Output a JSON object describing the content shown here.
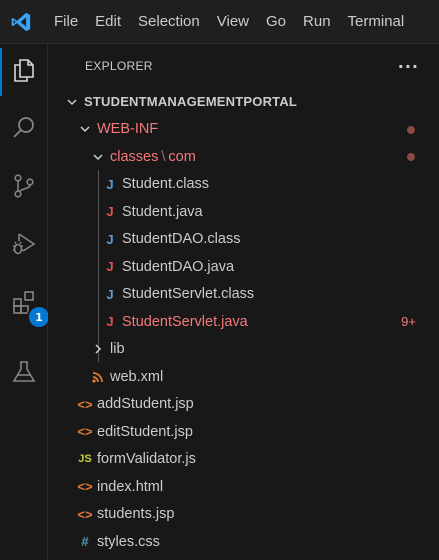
{
  "menu": [
    "File",
    "Edit",
    "Selection",
    "View",
    "Go",
    "Run",
    "Terminal"
  ],
  "activity_bar": {
    "items": [
      "explorer-icon",
      "search-icon",
      "source-control-icon",
      "run-debug-icon",
      "extensions-icon",
      "testing-icon"
    ],
    "extensions_badge": "1",
    "accent": "#0078d4"
  },
  "explorer": {
    "title": "EXPLORER",
    "more_actions": "···",
    "root": "STUDENTMANAGEMENTPORTAL",
    "webinf": "WEB-INF",
    "classes_path": {
      "part1": "classes",
      "separator": "\\",
      "part2": "com"
    },
    "files_com": [
      {
        "name": "Student.class",
        "icon": "java-class-icon",
        "icon_glyph": "J"
      },
      {
        "name": "Student.java",
        "icon": "java-file-icon",
        "icon_glyph": "J"
      },
      {
        "name": "StudentDAO.class",
        "icon": "java-class-icon",
        "icon_glyph": "J"
      },
      {
        "name": "StudentDAO.java",
        "icon": "java-file-icon",
        "icon_glyph": "J"
      },
      {
        "name": "StudentServlet.class",
        "icon": "java-class-icon",
        "icon_glyph": "J"
      },
      {
        "name": "StudentServlet.java",
        "icon": "java-file-icon",
        "icon_glyph": "J",
        "problems": "9+"
      }
    ],
    "lib": "lib",
    "webxml": "web.xml",
    "root_files": [
      {
        "name": "addStudent.jsp",
        "icon": "jsp-icon",
        "icon_glyph": "<>"
      },
      {
        "name": "editStudent.jsp",
        "icon": "jsp-icon",
        "icon_glyph": "<>"
      },
      {
        "name": "formValidator.js",
        "icon": "js-icon",
        "icon_glyph": "JS"
      },
      {
        "name": "index.html",
        "icon": "html-icon",
        "icon_glyph": "<>"
      },
      {
        "name": "students.jsp",
        "icon": "jsp-icon",
        "icon_glyph": "<>"
      },
      {
        "name": "styles.css",
        "icon": "css-icon",
        "icon_glyph": "#"
      }
    ],
    "colors": {
      "error_text": "#f47a7a",
      "java_class": "#5d9cd4",
      "java_file": "#e05252",
      "jsp": "#e37933",
      "js": "#cbcb41",
      "css": "#519aba",
      "xml": "#e37933"
    }
  }
}
